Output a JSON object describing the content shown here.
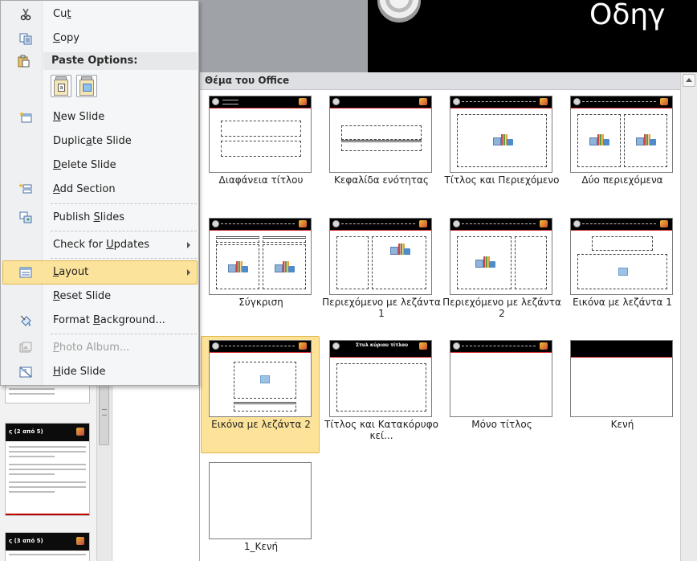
{
  "slide_title": "Οδηγ",
  "thumbnails": [
    {
      "header": "",
      "number": ""
    },
    {
      "header": "ς (2 από 5)",
      "number": ""
    },
    {
      "header": "ς (3 από 5)",
      "number": ""
    }
  ],
  "gallery": {
    "header": "Θέμα του Office",
    "layouts": [
      {
        "label": "Διαφάνεια τίτλου",
        "selected": false
      },
      {
        "label": "Κεφαλίδα ενότητας",
        "selected": false
      },
      {
        "label": "Τίτλος και Περιεχόμενο",
        "selected": false
      },
      {
        "label": "Δύο περιεχόμενα",
        "selected": false
      },
      {
        "label": "Σύγκριση",
        "selected": false
      },
      {
        "label": "Περιεχόμενο με λεζάντα 1",
        "selected": false
      },
      {
        "label": "Περιεχόμενο με λεζάντα 2",
        "selected": false
      },
      {
        "label": "Εικόνα με λεζάντα 1",
        "selected": false
      },
      {
        "label": "Εικόνα με λεζάντα 2",
        "selected": true
      },
      {
        "label": "Τίτλος και Κατακόρυφο κεί...",
        "selected": false,
        "header_text": "Στυλ κύριου τίτλου"
      },
      {
        "label": "Μόνο τίτλος",
        "selected": false
      },
      {
        "label": "Κενή",
        "selected": false
      },
      {
        "label": "1_Κενή",
        "selected": false
      }
    ]
  },
  "menu": {
    "cut": {
      "pre": "Cu",
      "key": "t",
      "post": "",
      "icon": "scissors-icon"
    },
    "copy": {
      "pre": "",
      "key": "C",
      "post": "opy",
      "icon": "copy-icon"
    },
    "paste_header": "Paste Options:",
    "new_slide": {
      "pre": "",
      "key": "N",
      "post": "ew Slide",
      "icon": "new-slide-icon"
    },
    "duplicate_slide": {
      "pre": "Duplic",
      "key": "a",
      "post": "te Slide"
    },
    "delete_slide": {
      "pre": "",
      "key": "D",
      "post": "elete Slide"
    },
    "add_section": {
      "pre": "",
      "key": "A",
      "post": "dd Section",
      "icon": "section-icon"
    },
    "publish_slides": {
      "pre": "Publish ",
      "key": "S",
      "post": "lides",
      "icon": "publish-icon"
    },
    "check_updates": {
      "pre": "Check for ",
      "key": "U",
      "post": "pdates"
    },
    "layout": {
      "pre": "",
      "key": "L",
      "post": "ayout",
      "icon": "layout-icon"
    },
    "reset_slide": {
      "pre": "",
      "key": "R",
      "post": "eset Slide"
    },
    "format_background": {
      "pre": "Format ",
      "key": "B",
      "post": "ackground...",
      "icon": "format-background-icon"
    },
    "photo_album": {
      "pre": "",
      "key": "P",
      "post": "hoto Album...",
      "icon": "photo-album-icon"
    },
    "hide_slide": {
      "pre": "",
      "key": "H",
      "post": "ide Slide",
      "icon": "hide-slide-icon"
    }
  },
  "colors": {
    "highlight": "#fbe39b",
    "highlight_border": "#e2b64f",
    "slide_bg": "#000000",
    "accent_red": "#c00000"
  }
}
